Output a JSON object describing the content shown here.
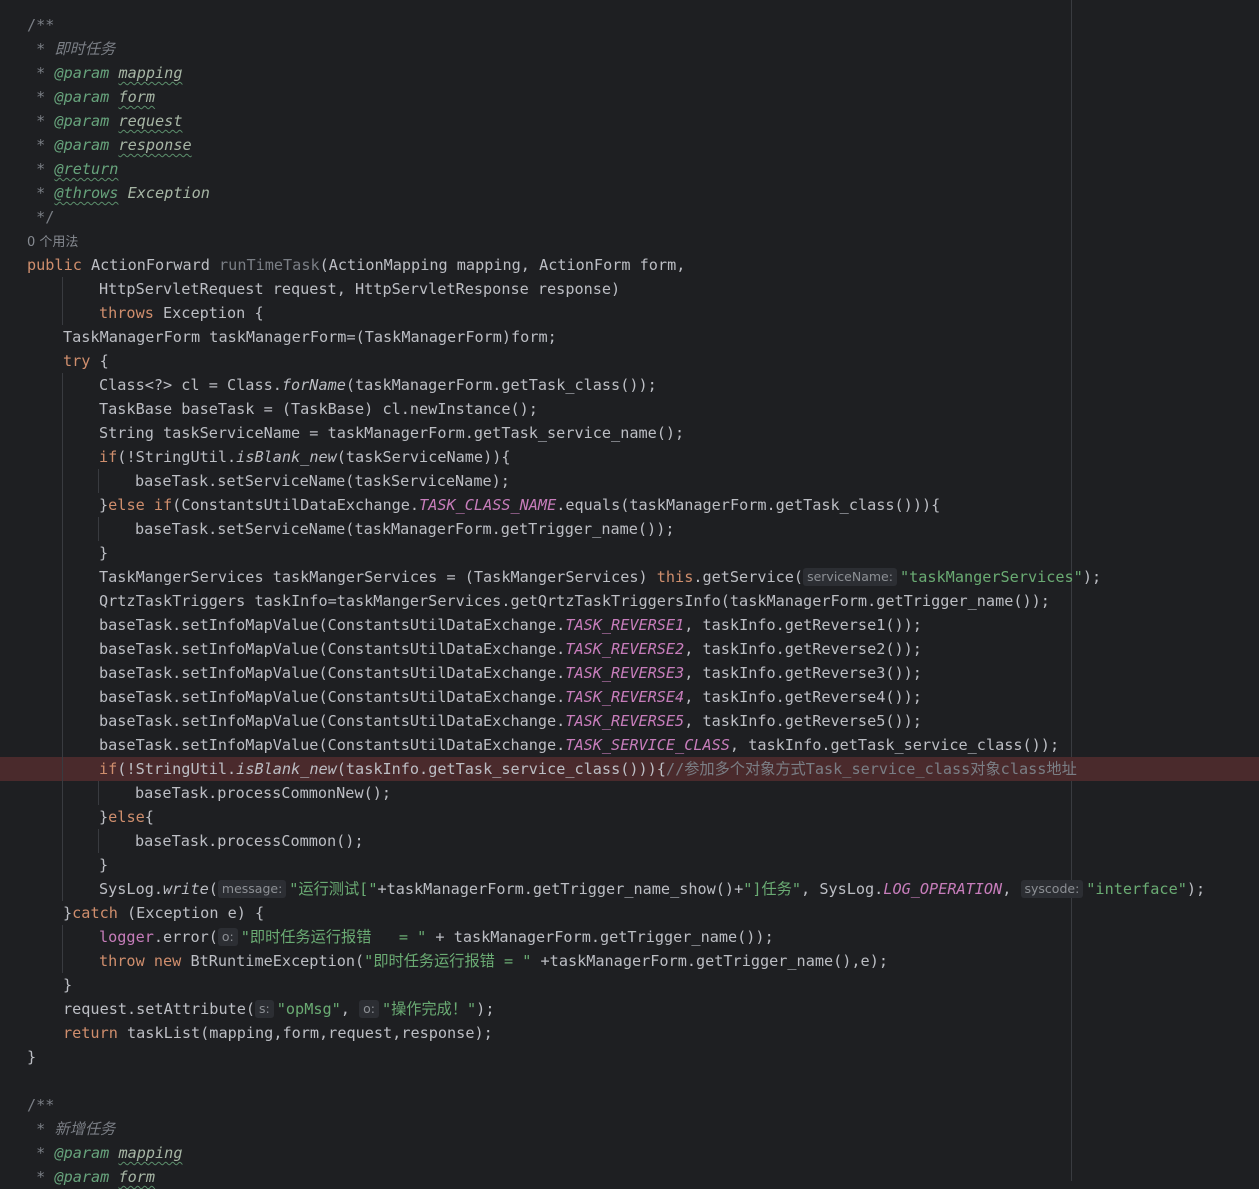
{
  "editor": {
    "language": "java",
    "colors": {
      "background": "#1e1f22",
      "text": "#bcbec4",
      "keyword": "#cf8e6d",
      "string": "#6aab73",
      "comment": "#7a7e85",
      "javadoc_tag": "#67a37c",
      "method_declaration": "#56a8f5",
      "static_constant": "#c77dbb",
      "highlighted_line": "#4a2a2c"
    },
    "lines": [
      {
        "indent": 0,
        "tokens": [
          {
            "t": "/**",
            "c": "cm"
          }
        ]
      },
      {
        "indent": 0,
        "tokens": [
          {
            "t": " * ",
            "c": "cm"
          },
          {
            "t": "即时任务",
            "c": "cmi"
          }
        ]
      },
      {
        "indent": 0,
        "tokens": [
          {
            "t": " * ",
            "c": "cm"
          },
          {
            "t": "@param",
            "c": "tag"
          },
          {
            "t": " ",
            "c": "cm"
          },
          {
            "t": "mapping",
            "c": "pu"
          }
        ]
      },
      {
        "indent": 0,
        "tokens": [
          {
            "t": " * ",
            "c": "cm"
          },
          {
            "t": "@param",
            "c": "tag"
          },
          {
            "t": " ",
            "c": "cm"
          },
          {
            "t": "form",
            "c": "pu"
          }
        ]
      },
      {
        "indent": 0,
        "tokens": [
          {
            "t": " * ",
            "c": "cm"
          },
          {
            "t": "@param",
            "c": "tag"
          },
          {
            "t": " ",
            "c": "cm"
          },
          {
            "t": "request",
            "c": "pu"
          }
        ]
      },
      {
        "indent": 0,
        "tokens": [
          {
            "t": " * ",
            "c": "cm"
          },
          {
            "t": "@param",
            "c": "tag"
          },
          {
            "t": " ",
            "c": "cm"
          },
          {
            "t": "response",
            "c": "pu"
          }
        ]
      },
      {
        "indent": 0,
        "tokens": [
          {
            "t": " * ",
            "c": "cm"
          },
          {
            "t": "@return",
            "c": "tagu"
          }
        ]
      },
      {
        "indent": 0,
        "tokens": [
          {
            "t": " * ",
            "c": "cm"
          },
          {
            "t": "@throws",
            "c": "tagu"
          },
          {
            "t": " ",
            "c": "cm"
          },
          {
            "t": "Exception",
            "c": "pi"
          }
        ]
      },
      {
        "indent": 0,
        "tokens": [
          {
            "t": " */",
            "c": "cm"
          }
        ]
      },
      {
        "indent": 0,
        "tokens": [
          {
            "t": "0 个用法",
            "c": "usage"
          }
        ]
      },
      {
        "indent": 0,
        "tokens": [
          {
            "t": "public ",
            "c": "kw"
          },
          {
            "t": "ActionForward "
          },
          {
            "t": "runTimeTask",
            "c": "unused"
          },
          {
            "t": "(ActionMapping mapping, ActionForm form,"
          }
        ]
      },
      {
        "indent": 2,
        "tokens": [
          {
            "t": "HttpServletRequest request, HttpServletResponse response)"
          }
        ]
      },
      {
        "indent": 2,
        "tokens": [
          {
            "t": "throws ",
            "c": "kw"
          },
          {
            "t": "Exception {"
          }
        ]
      },
      {
        "indent": 1,
        "tokens": [
          {
            "t": "TaskManagerForm taskManagerForm=(TaskManagerForm)form;"
          }
        ]
      },
      {
        "indent": 1,
        "tokens": [
          {
            "t": "try ",
            "c": "kw"
          },
          {
            "t": "{"
          }
        ]
      },
      {
        "indent": 2,
        "tokens": [
          {
            "t": "Class<?> cl = Class."
          },
          {
            "t": "forName",
            "c": "sm"
          },
          {
            "t": "(taskManagerForm.getTask_class());"
          }
        ]
      },
      {
        "indent": 2,
        "tokens": [
          {
            "t": "TaskBase baseTask = (TaskBase) cl.newInstance();"
          }
        ]
      },
      {
        "indent": 2,
        "tokens": [
          {
            "t": "String taskServiceName = taskManagerForm.getTask_service_name();"
          }
        ]
      },
      {
        "indent": 2,
        "tokens": [
          {
            "t": "if",
            "c": "kw"
          },
          {
            "t": "(!StringUtil."
          },
          {
            "t": "isBlank_new",
            "c": "sm"
          },
          {
            "t": "(taskServiceName)){"
          }
        ]
      },
      {
        "indent": 3,
        "tokens": [
          {
            "t": "baseTask.setServiceName(taskServiceName);"
          }
        ]
      },
      {
        "indent": 2,
        "tokens": [
          {
            "t": "}"
          },
          {
            "t": "else if",
            "c": "kw"
          },
          {
            "t": "(ConstantsUtilDataExchange."
          },
          {
            "t": "TASK_CLASS_NAME",
            "c": "cst"
          },
          {
            "t": ".equals(taskManagerForm.getTask_class())){"
          }
        ]
      },
      {
        "indent": 3,
        "tokens": [
          {
            "t": "baseTask.setServiceName(taskManagerForm.getTrigger_name());"
          }
        ]
      },
      {
        "indent": 2,
        "tokens": [
          {
            "t": "}"
          }
        ]
      },
      {
        "indent": 2,
        "tokens": [
          {
            "t": "TaskMangerServices taskMangerServices = (TaskMangerServices) "
          },
          {
            "t": "this",
            "c": "kw"
          },
          {
            "t": ".getService("
          },
          {
            "t": "serviceName:",
            "c": "hint"
          },
          {
            "t": "\"taskMangerServices\"",
            "c": "str"
          },
          {
            "t": ");"
          }
        ]
      },
      {
        "indent": 2,
        "tokens": [
          {
            "t": "QrtzTaskTriggers taskInfo=taskMangerServices.getQrtzTaskTriggersInfo(taskManagerForm.getTrigger_name());"
          }
        ]
      },
      {
        "indent": 2,
        "tokens": [
          {
            "t": "baseTask.setInfoMapValue(ConstantsUtilDataExchange."
          },
          {
            "t": "TASK_REVERSE1",
            "c": "cst"
          },
          {
            "t": ", taskInfo.getReverse1());"
          }
        ]
      },
      {
        "indent": 2,
        "tokens": [
          {
            "t": "baseTask.setInfoMapValue(ConstantsUtilDataExchange."
          },
          {
            "t": "TASK_REVERSE2",
            "c": "cst"
          },
          {
            "t": ", taskInfo.getReverse2());"
          }
        ]
      },
      {
        "indent": 2,
        "tokens": [
          {
            "t": "baseTask.setInfoMapValue(ConstantsUtilDataExchange."
          },
          {
            "t": "TASK_REVERSE3",
            "c": "cst"
          },
          {
            "t": ", taskInfo.getReverse3());"
          }
        ]
      },
      {
        "indent": 2,
        "tokens": [
          {
            "t": "baseTask.setInfoMapValue(ConstantsUtilDataExchange."
          },
          {
            "t": "TASK_REVERSE4",
            "c": "cst"
          },
          {
            "t": ", taskInfo.getReverse4());"
          }
        ]
      },
      {
        "indent": 2,
        "tokens": [
          {
            "t": "baseTask.setInfoMapValue(ConstantsUtilDataExchange."
          },
          {
            "t": "TASK_REVERSE5",
            "c": "cst"
          },
          {
            "t": ", taskInfo.getReverse5());"
          }
        ]
      },
      {
        "indent": 2,
        "tokens": [
          {
            "t": "baseTask.setInfoMapValue(ConstantsUtilDataExchange."
          },
          {
            "t": "TASK_SERVICE_CLASS",
            "c": "cst"
          },
          {
            "t": ", taskInfo.getTask_service_class());"
          }
        ]
      },
      {
        "indent": 2,
        "highlight": true,
        "tokens": [
          {
            "t": "if",
            "c": "kw"
          },
          {
            "t": "(!StringUtil."
          },
          {
            "t": "isBlank_new",
            "c": "sm"
          },
          {
            "t": "(taskInfo.getTask_service_class())){"
          },
          {
            "t": "//参加多个对象方式Task_service_class对象class地址",
            "c": "cm"
          }
        ]
      },
      {
        "indent": 3,
        "tokens": [
          {
            "t": "baseTask.processCommonNew();"
          }
        ]
      },
      {
        "indent": 2,
        "tokens": [
          {
            "t": "}"
          },
          {
            "t": "else",
            "c": "kw"
          },
          {
            "t": "{"
          }
        ]
      },
      {
        "indent": 3,
        "tokens": [
          {
            "t": "baseTask.processCommon();"
          }
        ]
      },
      {
        "indent": 2,
        "tokens": [
          {
            "t": "}"
          }
        ]
      },
      {
        "indent": 2,
        "tokens": [
          {
            "t": "SysLog."
          },
          {
            "t": "write",
            "c": "sm"
          },
          {
            "t": "("
          },
          {
            "t": "message:",
            "c": "hint"
          },
          {
            "t": "\"运行测试[\"",
            "c": "str"
          },
          {
            "t": "+taskManagerForm.getTrigger_name_show()+"
          },
          {
            "t": "\"]任务\"",
            "c": "str"
          },
          {
            "t": ", SysLog."
          },
          {
            "t": "LOG_OPERATION",
            "c": "cst"
          },
          {
            "t": ", "
          },
          {
            "t": "syscode:",
            "c": "hint"
          },
          {
            "t": "\"interface\"",
            "c": "str"
          },
          {
            "t": ");"
          }
        ]
      },
      {
        "indent": 1,
        "tokens": [
          {
            "t": "}"
          },
          {
            "t": "catch ",
            "c": "kw"
          },
          {
            "t": "(Exception e) {"
          }
        ]
      },
      {
        "indent": 2,
        "tokens": [
          {
            "t": "logger",
            "c": "fld"
          },
          {
            "t": ".error("
          },
          {
            "t": "o:",
            "c": "hint"
          },
          {
            "t": "\"即时任务运行报错   = \"",
            "c": "str"
          },
          {
            "t": " + taskManagerForm.getTrigger_name());"
          }
        ]
      },
      {
        "indent": 2,
        "tokens": [
          {
            "t": "throw new ",
            "c": "kw"
          },
          {
            "t": "BtRuntimeException("
          },
          {
            "t": "\"即时任务运行报错 = \"",
            "c": "str"
          },
          {
            "t": " +taskManagerForm.getTrigger_name(),e);"
          }
        ]
      },
      {
        "indent": 1,
        "tokens": [
          {
            "t": "}"
          }
        ]
      },
      {
        "indent": 1,
        "tokens": [
          {
            "t": "request.setAttribute("
          },
          {
            "t": "s:",
            "c": "hint"
          },
          {
            "t": "\"opMsg\"",
            "c": "str"
          },
          {
            "t": ", "
          },
          {
            "t": "o:",
            "c": "hint"
          },
          {
            "t": "\"操作完成！\"",
            "c": "str"
          },
          {
            "t": ");"
          }
        ]
      },
      {
        "indent": 1,
        "tokens": [
          {
            "t": "return ",
            "c": "kw"
          },
          {
            "t": "taskList(mapping,form,request,response);"
          }
        ]
      },
      {
        "indent": 0,
        "tokens": [
          {
            "t": "}"
          }
        ]
      },
      {
        "indent": 0,
        "tokens": []
      },
      {
        "indent": 0,
        "tokens": [
          {
            "t": "/**",
            "c": "cm"
          }
        ]
      },
      {
        "indent": 0,
        "tokens": [
          {
            "t": " * ",
            "c": "cm"
          },
          {
            "t": "新增任务",
            "c": "cmi"
          }
        ]
      },
      {
        "indent": 0,
        "tokens": [
          {
            "t": " * ",
            "c": "cm"
          },
          {
            "t": "@param",
            "c": "tag"
          },
          {
            "t": " ",
            "c": "cm"
          },
          {
            "t": "mapping",
            "c": "pu"
          }
        ]
      },
      {
        "indent": 0,
        "tokens": [
          {
            "t": " * ",
            "c": "cm"
          },
          {
            "t": "@param",
            "c": "tag"
          },
          {
            "t": " ",
            "c": "cm"
          },
          {
            "t": "form",
            "c": "pu"
          }
        ]
      }
    ]
  }
}
